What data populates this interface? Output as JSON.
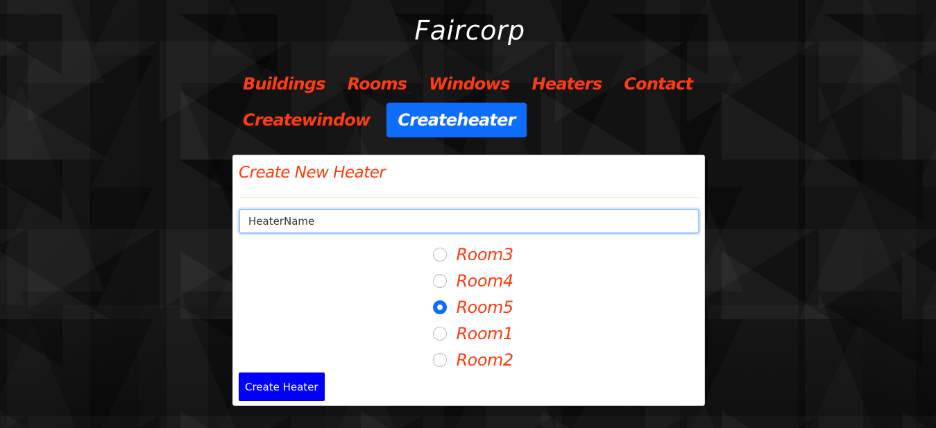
{
  "site": {
    "title": "Faircorp"
  },
  "nav": {
    "row1": [
      "Buildings",
      "Rooms",
      "Windows",
      "Heaters",
      "Contact"
    ],
    "row2": [
      "Createwindow",
      "Createheater"
    ],
    "active": "Createheater",
    "active_color": "#0d6efd",
    "link_color": "#ff3b0f"
  },
  "form": {
    "title": "Create New Heater",
    "name_value": "HeaterName",
    "rooms": [
      {
        "label": "Room3",
        "checked": false
      },
      {
        "label": "Room4",
        "checked": false
      },
      {
        "label": "Room5",
        "checked": true
      },
      {
        "label": "Room1",
        "checked": false
      },
      {
        "label": "Room2",
        "checked": false
      }
    ],
    "submit_label": "Create Heater",
    "submit_color": "#0000ff"
  }
}
